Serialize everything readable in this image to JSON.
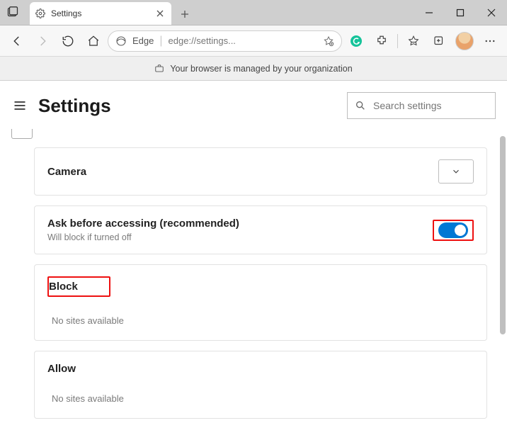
{
  "window": {
    "tab_title": "Settings"
  },
  "toolbar": {
    "browser_label": "Edge",
    "url": "edge://settings..."
  },
  "banner": {
    "managed_text": "Your browser is managed by your organization"
  },
  "settings": {
    "title": "Settings",
    "search_placeholder": "Search settings"
  },
  "camera": {
    "title": "Camera",
    "ask_title": "Ask before accessing (recommended)",
    "ask_sub": "Will block if turned off",
    "toggle_on": true
  },
  "lists": {
    "block": {
      "title": "Block",
      "empty": "No sites available"
    },
    "allow": {
      "title": "Allow",
      "empty": "No sites available"
    }
  }
}
